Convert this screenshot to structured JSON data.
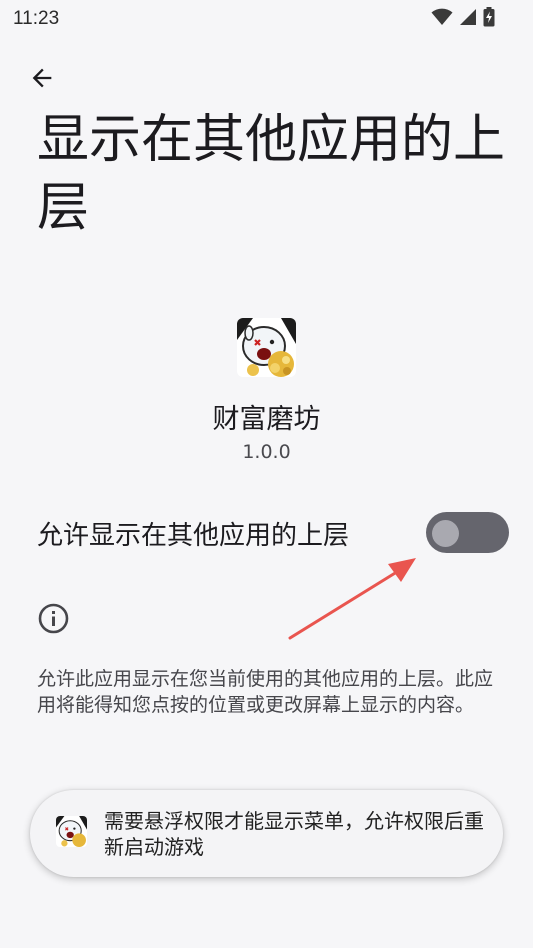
{
  "status_bar": {
    "time": "11:23"
  },
  "page": {
    "title": "显示在其他应用的上层"
  },
  "app": {
    "name": "财富磨坊",
    "version": "1.0.0"
  },
  "permission": {
    "toggle_label": "允许显示在其他应用的上层",
    "enabled": false,
    "description": "允许此应用显示在您当前使用的其他应用的上层。此应用将能得知您点按的位置或更改屏幕上显示的内容。"
  },
  "toast": {
    "message": "需要悬浮权限才能显示菜单，允许权限后重新启动游戏"
  },
  "icons": {
    "status": [
      "wifi-icon",
      "signal-icon",
      "battery-charging-icon"
    ],
    "back": "arrow-back-icon",
    "info": "info-icon",
    "annotation": "red-arrow"
  },
  "colors": {
    "background": "#f6f6f8",
    "switch_track": "#65656d",
    "switch_knob": "#a9a9b0",
    "annotation_arrow": "#e9554f"
  }
}
